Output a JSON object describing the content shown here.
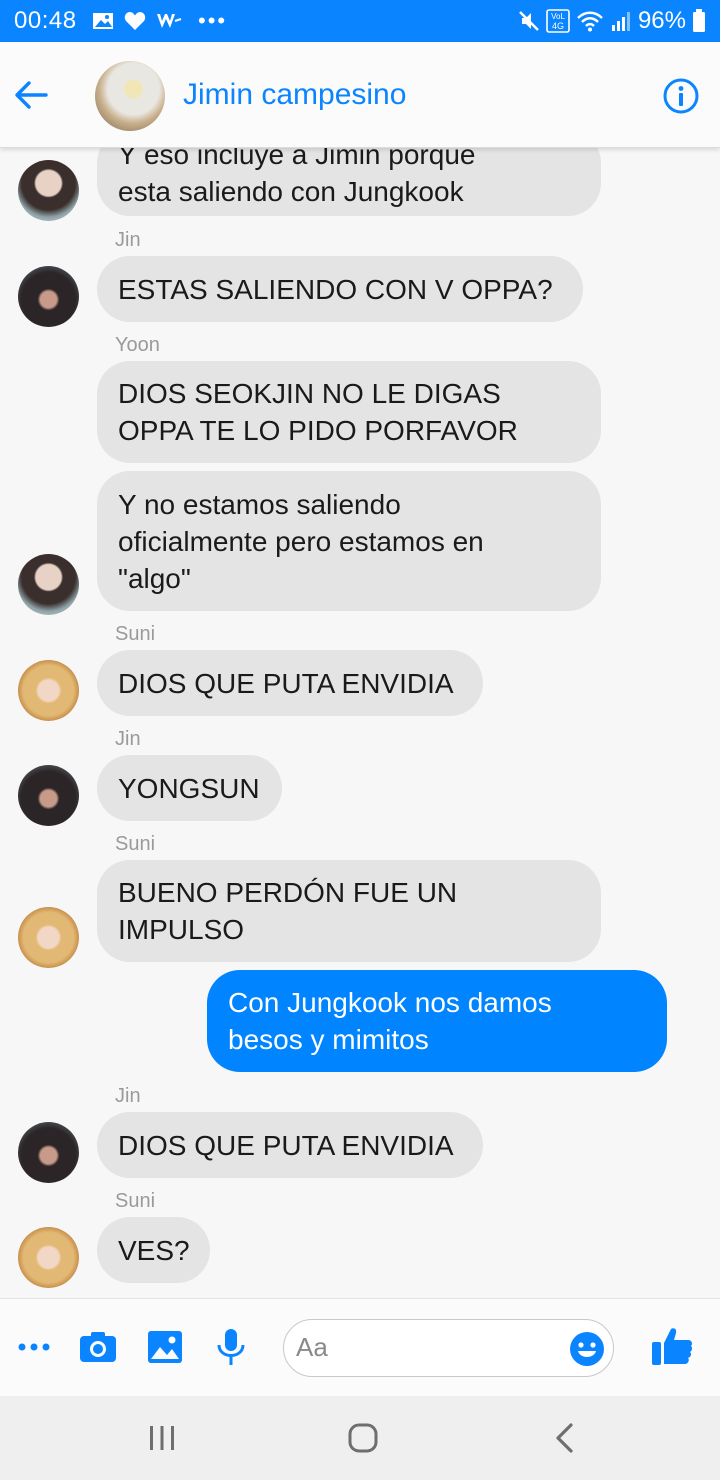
{
  "status_bar": {
    "time": "00:48",
    "battery": "96%",
    "network": "4G",
    "left_icons": [
      "picture-icon",
      "heart-icon",
      "webtoon-icon",
      "more-icon"
    ],
    "right_icons": [
      "mute-icon",
      "volte-icon",
      "wifi-icon",
      "signal-icon",
      "battery-icon"
    ],
    "color": "#0a84ff"
  },
  "header": {
    "title": "Jimin campesino",
    "back_icon": "back-arrow-icon",
    "info_icon": "info-icon",
    "accent": "#0a84ff"
  },
  "messages": [
    {
      "sender": "",
      "text": "Y eso incluye a Jimin porque\nesta saliendo con Jungkook",
      "avatar": "jungkook",
      "mine": false
    },
    {
      "sender": "Jin",
      "text": "ESTAS SALIENDO CON V OPPA?",
      "avatar": "jin",
      "mine": false
    },
    {
      "sender": "Yoon",
      "text": "DIOS SEOKJIN NO LE DIGAS\nOPPA TE LO PIDO PORFAVOR",
      "avatar": "",
      "mine": false
    },
    {
      "sender": "",
      "text": "Y no estamos saliendo\noficialmente pero estamos en\n\"algo\"",
      "avatar": "jungkook",
      "mine": false
    },
    {
      "sender": "Suni",
      "text": "DIOS QUE PUTA ENVIDIA",
      "avatar": "suni",
      "mine": false
    },
    {
      "sender": "Jin",
      "text": "YONGSUN",
      "avatar": "jin",
      "mine": false
    },
    {
      "sender": "Suni",
      "text": "BUENO PERDÓN FUE UN\nIMPULSO",
      "avatar": "suni",
      "mine": false
    },
    {
      "sender": "",
      "text": "Con Jungkook nos damos\nbesos y mimitos",
      "avatar": "",
      "mine": true
    },
    {
      "sender": "Jin",
      "text": "DIOS QUE PUTA ENVIDIA",
      "avatar": "jin",
      "mine": false
    },
    {
      "sender": "Suni",
      "text": "VES?",
      "avatar": "suni",
      "mine": false
    }
  ],
  "composer": {
    "placeholder": "Aa",
    "tools": [
      "more-icon",
      "camera-icon",
      "gallery-icon",
      "microphone-icon"
    ],
    "emoji_icon": "emoji-icon",
    "like_icon": "thumbs-up-icon"
  },
  "nav_bar": {
    "buttons": [
      "recents-icon",
      "home-icon",
      "back-icon"
    ]
  },
  "colors": {
    "bubble_other": "#e4e4e4",
    "bubble_mine": "#0084ff",
    "sender_label": "#9a9a9a"
  }
}
